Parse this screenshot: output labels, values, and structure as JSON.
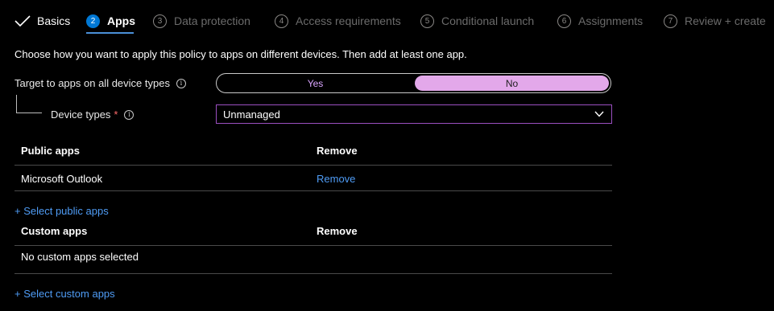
{
  "wizard": {
    "steps": [
      {
        "label": "Basics",
        "state": "done"
      },
      {
        "number": "2",
        "label": "Apps",
        "state": "active"
      },
      {
        "number": "3",
        "label": "Data protection"
      },
      {
        "number": "4",
        "label": "Access requirements"
      },
      {
        "number": "5",
        "label": "Conditional launch"
      },
      {
        "number": "6",
        "label": "Assignments"
      },
      {
        "number": "7",
        "label": "Review + create"
      }
    ]
  },
  "intro": "Choose how you want to apply this policy to apps on different devices. Then add at least one app.",
  "target_all": {
    "label": "Target to apps on all device types",
    "info_glyph": "i",
    "options": [
      "Yes",
      "No"
    ],
    "selected": "No"
  },
  "device_types": {
    "label": "Device types",
    "required_mark": "*",
    "info_glyph": "i",
    "value": "Unmanaged"
  },
  "public_apps": {
    "headers": [
      "Public apps",
      "Remove"
    ],
    "rows": [
      {
        "name": "Microsoft Outlook",
        "action": "Remove"
      }
    ],
    "add_link": "+ Select public apps"
  },
  "custom_apps": {
    "headers": [
      "Custom apps",
      "Remove"
    ],
    "empty": "No custom apps selected",
    "add_link": "+ Select custom apps"
  },
  "colors": {
    "background": "#000000",
    "accent": "#0078d4",
    "link": "#4f9cf5",
    "toggle_selected": "#e3a8ea",
    "select_border": "#9a4fc0"
  }
}
